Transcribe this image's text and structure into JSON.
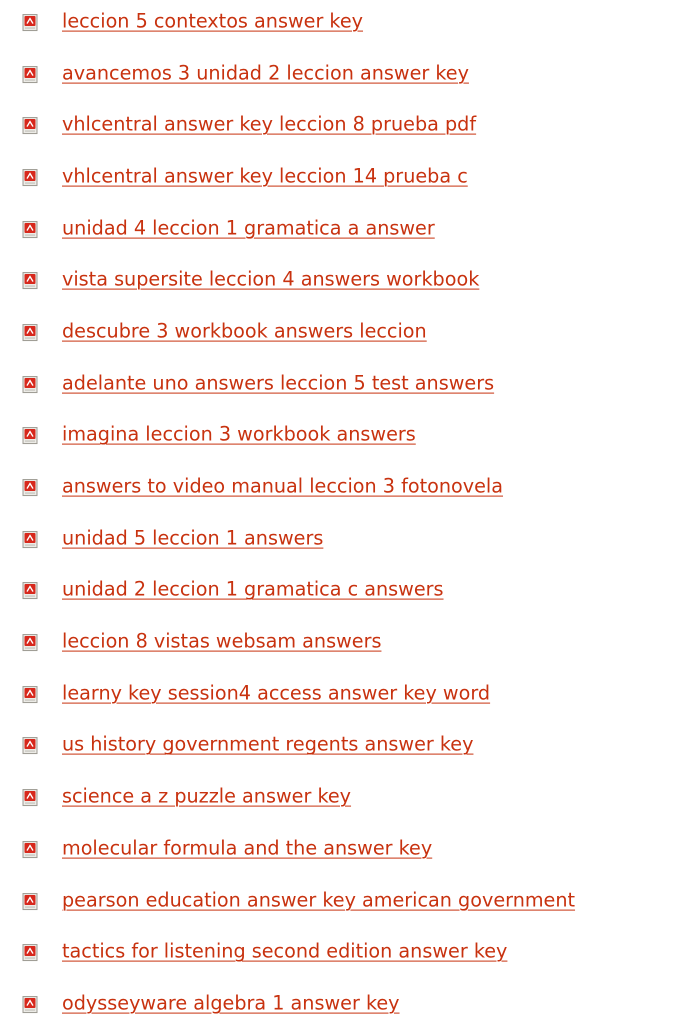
{
  "icon": "pdf-file-icon",
  "colors": {
    "link": "#c8320f",
    "icon_red": "#d7281c",
    "icon_page": "#ecebe6"
  },
  "links": [
    {
      "label": "leccion 5 contextos answer key"
    },
    {
      "label": "avancemos 3 unidad 2 leccion answer key"
    },
    {
      "label": "vhlcentral answer key leccion 8 prueba pdf"
    },
    {
      "label": "vhlcentral answer key leccion 14 prueba c"
    },
    {
      "label": "unidad 4 leccion 1 gramatica a answer"
    },
    {
      "label": "vista supersite leccion 4 answers workbook"
    },
    {
      "label": "descubre 3 workbook answers leccion"
    },
    {
      "label": "adelante uno answers leccion 5 test answers"
    },
    {
      "label": "imagina leccion 3 workbook answers"
    },
    {
      "label": "answers to video manual leccion 3 fotonovela"
    },
    {
      "label": "unidad 5 leccion 1 answers"
    },
    {
      "label": "unidad 2 leccion 1 gramatica c answers"
    },
    {
      "label": "leccion 8 vistas websam answers"
    },
    {
      "label": "learny key session4 access answer key word"
    },
    {
      "label": "us history government regents answer key"
    },
    {
      "label": "science a z puzzle answer key"
    },
    {
      "label": "molecular formula and the answer key"
    },
    {
      "label": "pearson education answer key american government"
    },
    {
      "label": "tactics for listening second edition answer key"
    },
    {
      "label": "odysseyware algebra 1 answer key"
    }
  ]
}
